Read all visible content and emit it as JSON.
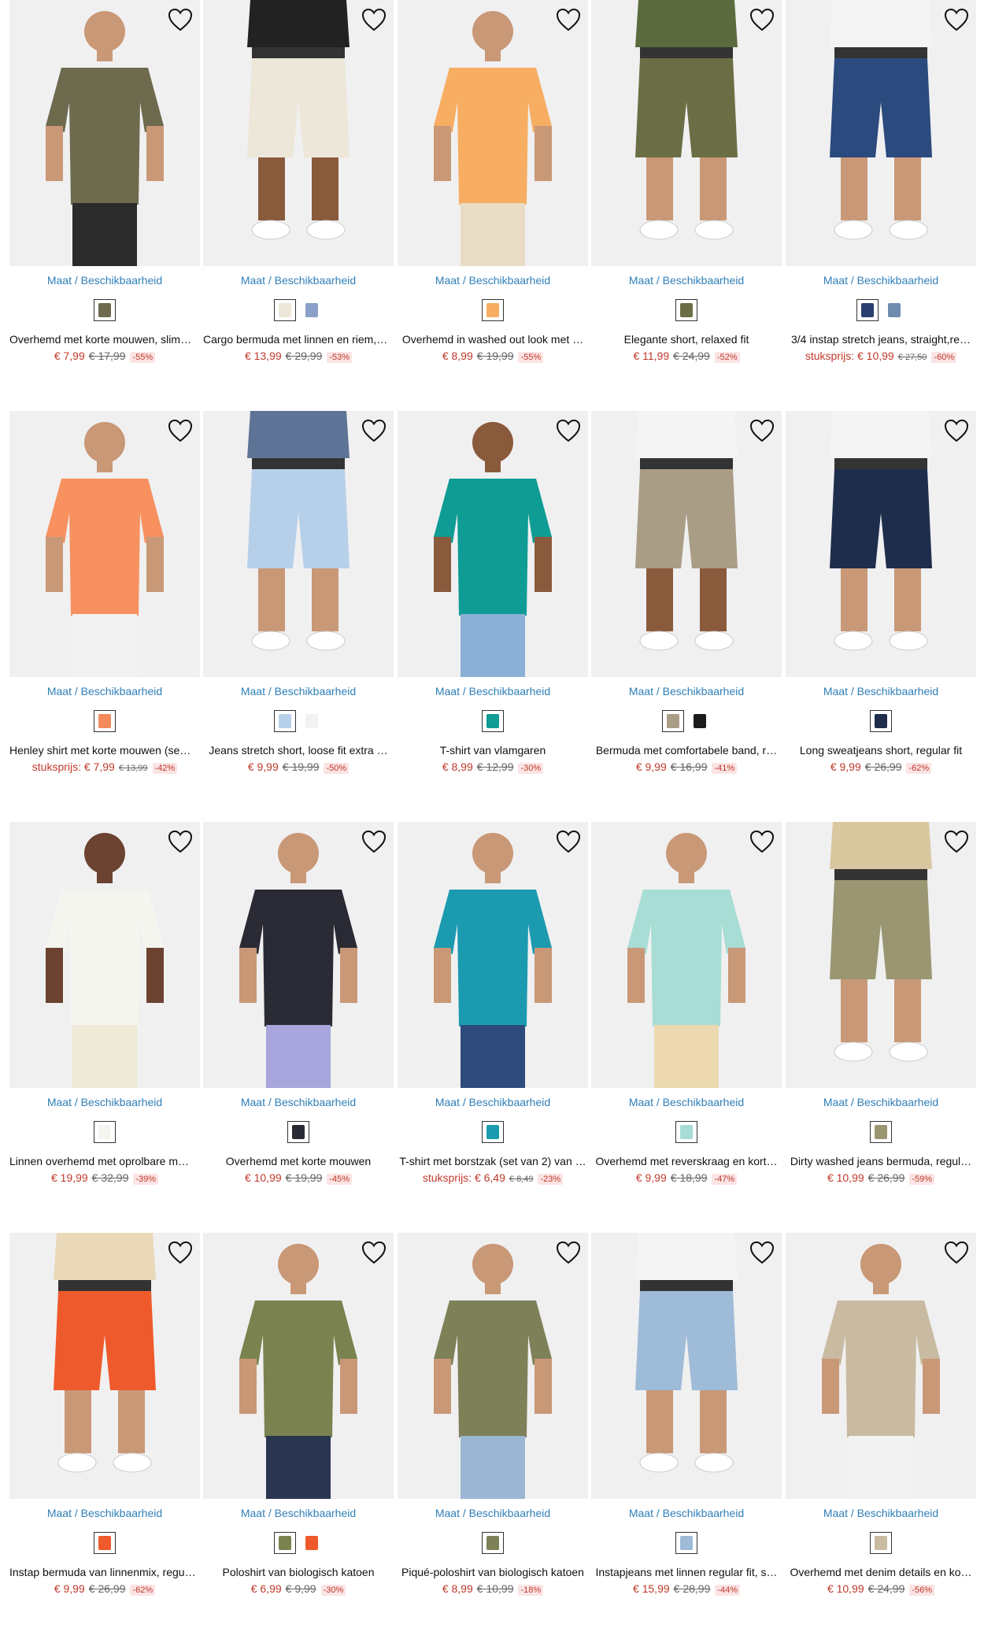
{
  "size_label": "Maat / Beschikbaarheid",
  "products": [
    {
      "title": "Overhemd met korte mouwen, slim…",
      "prefix": "",
      "price": "€ 7,99",
      "old": "€ 17,99",
      "discount": "-55%",
      "swatches": [
        "#6d6a4e"
      ]
    },
    {
      "title": "Cargo bermuda met linnen en riem,…",
      "prefix": "",
      "price": "€ 13,99",
      "old": "€ 29,99",
      "discount": "-53%",
      "swatches": [
        "#ede7da",
        "#8aa0c8"
      ]
    },
    {
      "title": "Overhemd in washed out look met …",
      "prefix": "",
      "price": "€ 8,99",
      "old": "€ 19,99",
      "discount": "-55%",
      "swatches": [
        "#f7ae62"
      ]
    },
    {
      "title": "Elegante short, relaxed fit",
      "prefix": "",
      "price": "€ 11,99",
      "old": "€ 24,99",
      "discount": "-52%",
      "swatches": [
        "#6b6e44"
      ]
    },
    {
      "title": "3/4 instap stretch jeans, straight,re…",
      "prefix": "stuksprijs: ",
      "price": "€ 10,99",
      "old": "€ 27,50",
      "discount": "-60%",
      "swatches": [
        "#2b3f6e",
        "#6f8cb0"
      ]
    },
    {
      "title": "Henley shirt met korte mouwen (se…",
      "prefix": "stuksprijs: ",
      "price": "€ 7,99",
      "old": "€ 13,99",
      "discount": "-42%",
      "swatches": [
        "#f28a5c"
      ]
    },
    {
      "title": "Jeans stretch short, loose fit extra …",
      "prefix": "",
      "price": "€ 9,99",
      "old": "€ 19,99",
      "discount": "-50%",
      "swatches": [
        "#b7d0ea",
        "#f2f2f2"
      ]
    },
    {
      "title": "T-shirt van vlamgaren",
      "prefix": "",
      "price": "€ 8,99",
      "old": "€ 12,99",
      "discount": "-30%",
      "swatches": [
        "#0f9c95"
      ]
    },
    {
      "title": "Bermuda met comfortabele band, r…",
      "prefix": "",
      "price": "€ 9,99",
      "old": "€ 16,99",
      "discount": "-41%",
      "swatches": [
        "#a99d86",
        "#1b1b1b"
      ]
    },
    {
      "title": "Long sweatjeans short, regular fit",
      "prefix": "",
      "price": "€ 9,99",
      "old": "€ 26,99",
      "discount": "-62%",
      "swatches": [
        "#1f2d4d"
      ]
    },
    {
      "title": "Linnen overhemd met oprolbare m…",
      "prefix": "",
      "price": "€ 19,99",
      "old": "€ 32,99",
      "discount": "-39%",
      "swatches": [
        "#f5f5f0"
      ]
    },
    {
      "title": "Overhemd met korte mouwen",
      "prefix": "",
      "price": "€ 10,99",
      "old": "€ 19,99",
      "discount": "-45%",
      "swatches": [
        "#2a2a35"
      ]
    },
    {
      "title": "T-shirt met borstzak (set van 2) van …",
      "prefix": "stuksprijs: ",
      "price": "€ 6,49",
      "old": "€ 8,49",
      "discount": "-23%",
      "swatches": [
        "#1c9bb0"
      ]
    },
    {
      "title": "Overhemd met reverskraag en kort…",
      "prefix": "",
      "price": "€ 9,99",
      "old": "€ 18,99",
      "discount": "-47%",
      "swatches": [
        "#a7ddd5"
      ]
    },
    {
      "title": "Dirty washed jeans bermuda, regul…",
      "prefix": "",
      "price": "€ 10,99",
      "old": "€ 26,99",
      "discount": "-59%",
      "swatches": [
        "#9a9672"
      ]
    },
    {
      "title": "Instap bermuda van linnenmix, regu…",
      "prefix": "",
      "price": "€ 9,99",
      "old": "€ 26,99",
      "discount": "-62%",
      "swatches": [
        "#ef5a2c"
      ]
    },
    {
      "title": "Poloshirt van biologisch katoen",
      "prefix": "",
      "price": "€ 6,99",
      "old": "€ 9,99",
      "discount": "-30%",
      "swatches": [
        "#7a8350",
        "#ef5a2c"
      ]
    },
    {
      "title": "Piqué-poloshirt van biologisch katoen",
      "prefix": "",
      "price": "€ 8,99",
      "old": "€ 10,99",
      "discount": "-18%",
      "swatches": [
        "#7e8058"
      ]
    },
    {
      "title": "Instapjeans met linnen regular fit, s…",
      "prefix": "",
      "price": "€ 15,99",
      "old": "€ 28,99",
      "discount": "-44%",
      "swatches": [
        "#9ebbd8"
      ]
    },
    {
      "title": "Overhemd met denim details en ko…",
      "prefix": "",
      "price": "€ 10,99",
      "old": "€ 24,99",
      "discount": "-56%",
      "swatches": [
        "#c9bba1"
      ]
    }
  ],
  "colors": {
    "accent_link": "#2f7fb8",
    "price": "#c0392b",
    "discount_bg": "#fbe4e4"
  }
}
